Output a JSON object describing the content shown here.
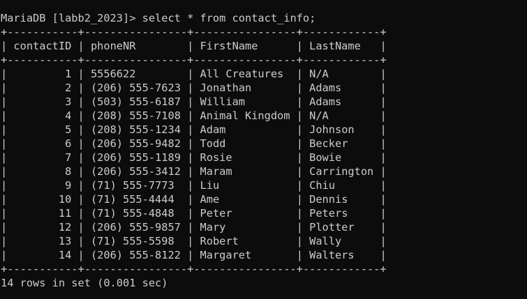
{
  "terminal": {
    "prompt": "MariaDB [labb2_2023]>",
    "command": "select * from contact_info;",
    "columns": [
      "contactID",
      "phoneNR",
      "FirstName",
      "LastName"
    ],
    "rows": [
      [
        "1",
        "5556622",
        "All Creatures",
        "N/A"
      ],
      [
        "2",
        "(206) 555-7623",
        "Jonathan",
        "Adams"
      ],
      [
        "3",
        "(503) 555-6187",
        "William",
        "Adams"
      ],
      [
        "4",
        "(208) 555-7108",
        "Animal Kingdom",
        "N/A"
      ],
      [
        "5",
        "(208) 555-1234",
        "Adam",
        "Johnson"
      ],
      [
        "6",
        "(206) 555-9482",
        "Todd",
        "Becker"
      ],
      [
        "7",
        "(206) 555-1189",
        "Rosie",
        "Bowie"
      ],
      [
        "8",
        "(206) 555-3412",
        "Maram",
        "Carrington"
      ],
      [
        "9",
        "(71) 555-7773",
        "Liu",
        "Chiu"
      ],
      [
        "10",
        "(71) 555-4444",
        "Ame",
        "Dennis"
      ],
      [
        "11",
        "(71) 555-4848",
        "Peter",
        "Peters"
      ],
      [
        "12",
        "(206) 555-9857",
        "Mary",
        "Plotter"
      ],
      [
        "13",
        "(71) 555-5598",
        "Robert",
        "Wally"
      ],
      [
        "14",
        "(206) 555-8122",
        "Margaret",
        "Walters"
      ]
    ],
    "result_summary": "14 rows in set (0.001 sec)"
  }
}
